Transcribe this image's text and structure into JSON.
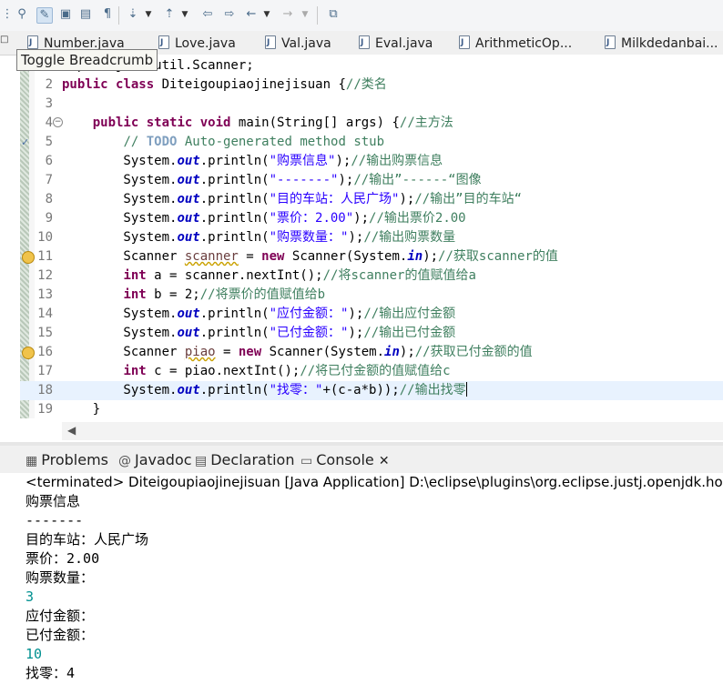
{
  "toolbar": {
    "icons": [
      "toolbar-menu-icon",
      "open-type-icon",
      "toggle-breadcrumb-icon",
      "mark-occurrences-icon",
      "block-selection-icon",
      "show-whitespace-icon",
      "next-annotation-icon",
      "previous-annotation-icon",
      "last-edit-location-icon",
      "back-icon",
      "forward-icon",
      "pin-editor-icon"
    ]
  },
  "tooltip": "Toggle Breadcrumb",
  "tabs": [
    "Number.java",
    "Love.java",
    "Val.java",
    "Eval.java",
    "ArithmeticOp...",
    "Milkdedanbai..."
  ],
  "editor": {
    "lines": [
      {
        "n": "",
        "html": "import java.util.Scanner;"
      },
      {
        "n": "2",
        "html": "<span class=\"kw\">public</span> <span class=\"kw\">class</span> Diteigoupiaojinejisuan {<span class=\"cm\">//类名</span>"
      },
      {
        "n": "3",
        "html": ""
      },
      {
        "n": "4",
        "html": "    <span class=\"kw\">public</span> <span class=\"kw\">static</span> <span class=\"kw\">void</span> main(String[] args) {<span class=\"cm\">//主方法</span>"
      },
      {
        "n": "5",
        "html": "        <span class=\"cm\">// </span><span class=\"todo\">TODO</span><span class=\"cm\"> Auto-generated method stub</span>"
      },
      {
        "n": "6",
        "html": "        System.<span class=\"fi\">out</span>.println(<span class=\"st\">\"购票信息\"</span>);<span class=\"cm\">//输出购票信息</span>"
      },
      {
        "n": "7",
        "html": "        System.<span class=\"fi\">out</span>.println(<span class=\"st\">\"-------\"</span>);<span class=\"cm\">//输出”------“图像</span>"
      },
      {
        "n": "8",
        "html": "        System.<span class=\"fi\">out</span>.println(<span class=\"st\">\"目的车站：人民广场\"</span>);<span class=\"cm\">//输出”目的车站“</span>"
      },
      {
        "n": "9",
        "html": "        System.<span class=\"fi\">out</span>.println(<span class=\"st\">\"票价：2.00\"</span>);<span class=\"cm\">//输出票价2.00</span>"
      },
      {
        "n": "10",
        "html": "        System.<span class=\"fi\">out</span>.println(<span class=\"st\">\"购票数量：\"</span>);<span class=\"cm\">//输出购票数量</span>"
      },
      {
        "n": "11",
        "html": "        Scanner <span class=\"var\">scanner</span> = <span class=\"kw\">new</span> Scanner(System.<span class=\"fi\">in</span>);<span class=\"cm\">//获取scanner的值</span>"
      },
      {
        "n": "12",
        "html": "        <span class=\"kw\">int</span> a = scanner.nextInt();<span class=\"cm\">//将scanner的值赋值给a</span>"
      },
      {
        "n": "13",
        "html": "        <span class=\"kw\">int</span> b = 2;<span class=\"cm\">//将票价的值赋值给b</span>"
      },
      {
        "n": "14",
        "html": "        System.<span class=\"fi\">out</span>.println(<span class=\"st\">\"应付金额：\"</span>);<span class=\"cm\">//输出应付金额</span>"
      },
      {
        "n": "15",
        "html": "        System.<span class=\"fi\">out</span>.println(<span class=\"st\">\"已付金额：\"</span>);<span class=\"cm\">//输出已付金额</span>"
      },
      {
        "n": "16",
        "html": "        Scanner <span class=\"var\">piao</span> = <span class=\"kw\">new</span> Scanner(System.<span class=\"fi\">in</span>);<span class=\"cm\">//获取已付金额的值</span>"
      },
      {
        "n": "17",
        "html": "        <span class=\"kw\">int</span> c = piao.nextInt();<span class=\"cm\">//将已付金额的值赋值给c</span>"
      },
      {
        "n": "18",
        "html": "        System.<span class=\"fi\">out</span>.println(<span class=\"st\">\"找零：\"</span>+(c-a*b));<span class=\"cm\">//输出找零</span><span class=\"caret\"></span>"
      },
      {
        "n": "19",
        "html": "    }"
      }
    ]
  },
  "views": {
    "tabs": [
      {
        "label": "Problems",
        "icon": "problems-icon"
      },
      {
        "label": "Javadoc",
        "icon": "javadoc-icon"
      },
      {
        "label": "Declaration",
        "icon": "declaration-icon"
      },
      {
        "label": "Console",
        "icon": "console-icon"
      }
    ],
    "close": "✕"
  },
  "console": {
    "header": "<terminated> Diteigoupiaojinejisuan [Java Application] D:\\eclipse\\plugins\\org.eclipse.justj.openjdk.hotspot",
    "lines": [
      {
        "text": "购票信息",
        "input": false
      },
      {
        "text": "-------",
        "input": false
      },
      {
        "text": "目的车站：人民广场",
        "input": false
      },
      {
        "text": "票价：2.00",
        "input": false
      },
      {
        "text": "购票数量：",
        "input": false
      },
      {
        "text": "3",
        "input": true
      },
      {
        "text": "应付金额：",
        "input": false
      },
      {
        "text": "已付金额：",
        "input": false
      },
      {
        "text": "10",
        "input": true
      },
      {
        "text": "找零：4",
        "input": false
      }
    ]
  }
}
